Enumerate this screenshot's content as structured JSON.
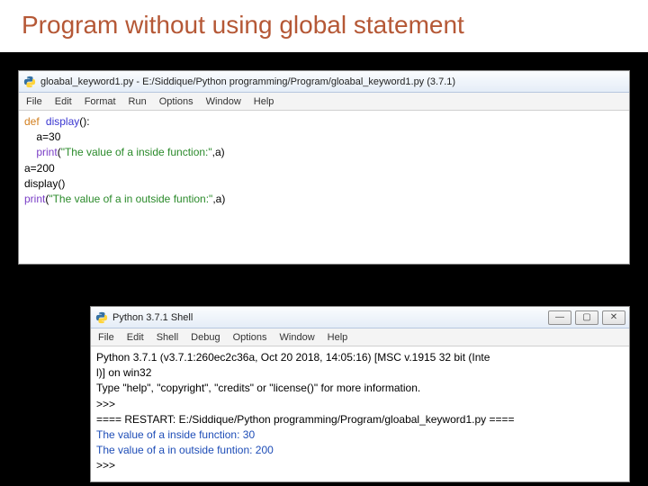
{
  "heading": "Program without using global statement",
  "editor": {
    "title": "gloabal_keyword1.py - E:/Siddique/Python programming/Program/gloabal_keyword1.py (3.7.1)",
    "menu": {
      "file": "File",
      "edit": "Edit",
      "format": "Format",
      "run": "Run",
      "options": "Options",
      "window": "Window",
      "help": "Help"
    },
    "code": {
      "l1_def": "def",
      "l1_name": "display",
      "l1_rest": "():",
      "l2": "    a=30",
      "l3_a": "    ",
      "l3_print": "print",
      "l3_p1": "(",
      "l3_str": "\"The value of a inside function:\"",
      "l3_p2": ",a)",
      "l4": "a=200",
      "l5": "display()",
      "l6_print": "print",
      "l6_p1": "(",
      "l6_str": "\"The value of a in outside funtion:\"",
      "l6_p2": ",a)"
    }
  },
  "shell": {
    "title": "Python 3.7.1 Shell",
    "menu": {
      "file": "File",
      "edit": "Edit",
      "shell": "Shell",
      "debug": "Debug",
      "options": "Options",
      "window": "Window",
      "help": "Help"
    },
    "lines": {
      "v1": "Python 3.7.1 (v3.7.1:260ec2c36a, Oct 20 2018, 14:05:16) [MSC v.1915 32 bit (Inte",
      "v2": "l)] on win32",
      "v3": "Type \"help\", \"copyright\", \"credits\" or \"license()\" for more information.",
      "p1": ">>>",
      "restart": "==== RESTART: E:/Siddique/Python programming/Program/gloabal_keyword1.py ====",
      "o1": "The value of a inside function: 30",
      "o2": "The value of a in outside funtion: 200",
      "p2": ">>>"
    },
    "winctrl": {
      "min": "—",
      "max": "▢",
      "close": "✕"
    }
  }
}
